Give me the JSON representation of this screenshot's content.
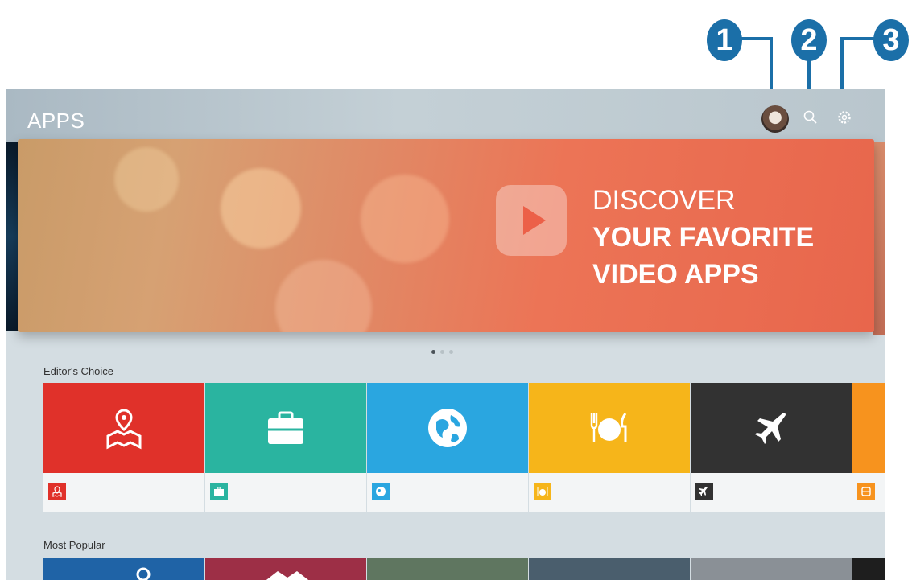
{
  "callouts": [
    "1",
    "2",
    "3"
  ],
  "header": {
    "title": "APPS",
    "icons": [
      "profile-avatar",
      "search-icon",
      "settings-icon"
    ]
  },
  "banner": {
    "line1": "DISCOVER",
    "line2": "YOUR FAVORITE",
    "line3": "VIDEO APPS",
    "page_indicator": {
      "total": 3,
      "active": 1
    }
  },
  "sections": {
    "editors_choice": "Editor's Choice",
    "most_popular": "Most Popular"
  },
  "editors_choice_tiles": [
    {
      "icon": "map-pin-icon",
      "color": "#e0312a"
    },
    {
      "icon": "briefcase-icon",
      "color": "#2ab4a0"
    },
    {
      "icon": "globe-icon",
      "color": "#2aa6e0"
    },
    {
      "icon": "dining-icon",
      "color": "#f6b51a"
    },
    {
      "icon": "airplane-icon",
      "color": "#323232"
    },
    {
      "icon": "bus-icon",
      "color": "#f7931e"
    }
  ],
  "most_popular_tiles": [
    {
      "color": "#1f63a6"
    },
    {
      "color": "#9d2f46"
    },
    {
      "color": "#5f7660"
    },
    {
      "color": "#4a5e6d"
    },
    {
      "color": "#8a9096"
    },
    {
      "color": "#1e1e1e"
    }
  ]
}
